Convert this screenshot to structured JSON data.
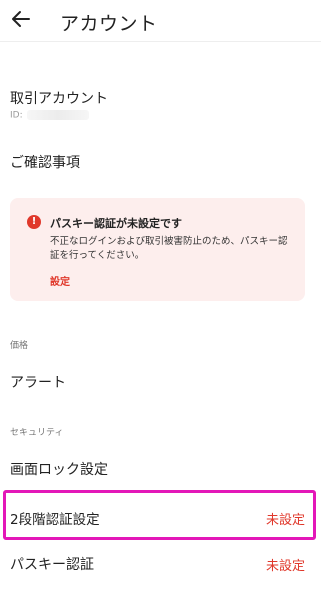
{
  "header": {
    "title": "アカウント",
    "back_icon": "arrow-left-icon"
  },
  "account": {
    "label": "取引アカウント",
    "id_prefix": "ID:"
  },
  "confirm": {
    "label": "ご確認事項"
  },
  "alert": {
    "title": "パスキー認証が未設定です",
    "body": "不正なログインおよび取引被害防止のため、パスキー認証を行ってください。",
    "link": "設定",
    "icon": "exclamation-icon",
    "icon_glyph": "!",
    "color": "#e0382b",
    "background": "#fdeeed"
  },
  "sections": {
    "price": "価格",
    "security": "セキュリティ"
  },
  "items": {
    "alarm": "アラート",
    "screen_lock": "画面ロック設定",
    "two_factor": {
      "label": "2段階認証設定",
      "status": "未設定"
    },
    "passkey": {
      "label": "パスキー認証",
      "status": "未設定"
    }
  },
  "colors": {
    "status_red": "#e0382b",
    "highlight": "#e317b8"
  }
}
